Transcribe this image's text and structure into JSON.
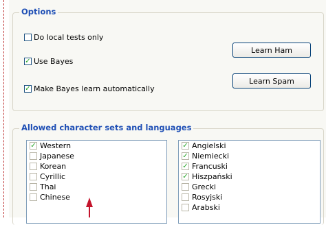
{
  "options": {
    "title": "Options",
    "do_local_tests": {
      "label": "Do local tests only",
      "checked": false
    },
    "use_bayes": {
      "label": "Use Bayes",
      "checked": true
    },
    "make_bayes_learn": {
      "label": "Make Bayes learn automatically",
      "checked": true
    },
    "learn_ham_label": "Learn Ham",
    "learn_spam_label": "Learn Spam"
  },
  "charsets": {
    "title": "Allowed character sets and languages",
    "left": [
      {
        "label": "Western",
        "checked": true
      },
      {
        "label": "Japanese",
        "checked": false
      },
      {
        "label": "Korean",
        "checked": false
      },
      {
        "label": "Cyrillic",
        "checked": false
      },
      {
        "label": "Thai",
        "checked": false
      },
      {
        "label": "Chinese",
        "checked": false
      }
    ],
    "right": [
      {
        "label": "Angielski",
        "checked": true
      },
      {
        "label": "Niemiecki",
        "checked": true
      },
      {
        "label": "Francuski",
        "checked": true
      },
      {
        "label": "Hiszpański",
        "checked": true
      },
      {
        "label": "Grecki",
        "checked": false
      },
      {
        "label": "Rosyjski",
        "checked": false
      },
      {
        "label": "Arabski",
        "checked": false
      }
    ]
  },
  "colors": {
    "accent": "#1f4fb5",
    "check": "#21a121",
    "annotation_arrow": "#c4142c"
  }
}
